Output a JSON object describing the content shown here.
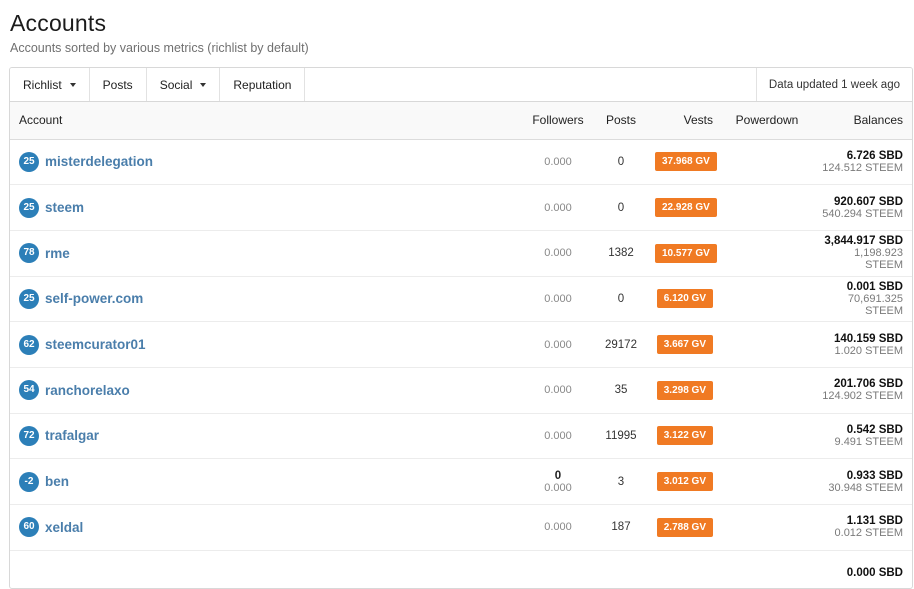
{
  "header": {
    "title": "Accounts",
    "subtitle": "Accounts sorted by various metrics (richlist by default)"
  },
  "toolbar": {
    "richlist": "Richlist",
    "posts": "Posts",
    "social": "Social",
    "reputation": "Reputation",
    "updated": "Data updated 1 week ago"
  },
  "table": {
    "columns": {
      "account": "Account",
      "followers": "Followers",
      "posts": "Posts",
      "vests": "Vests",
      "powerdown": "Powerdown",
      "balances": "Balances"
    },
    "rows": [
      {
        "rep": "25",
        "name": "misterdelegation",
        "followers_count": "",
        "followers": "0.000",
        "posts": "0",
        "vests": "37.968 GV",
        "sbd": "6.726 SBD",
        "steem": "124.512 STEEM"
      },
      {
        "rep": "25",
        "name": "steem",
        "followers_count": "",
        "followers": "0.000",
        "posts": "0",
        "vests": "22.928 GV",
        "sbd": "920.607 SBD",
        "steem": "540.294 STEEM"
      },
      {
        "rep": "78",
        "name": "rme",
        "followers_count": "",
        "followers": "0.000",
        "posts": "1382",
        "vests": "10.577 GV",
        "sbd": "3,844.917 SBD",
        "steem": "1,198.923 STEEM"
      },
      {
        "rep": "25",
        "name": "self-power.com",
        "followers_count": "",
        "followers": "0.000",
        "posts": "0",
        "vests": "6.120 GV",
        "sbd": "0.001 SBD",
        "steem": "70,691.325 STEEM"
      },
      {
        "rep": "62",
        "name": "steemcurator01",
        "followers_count": "",
        "followers": "0.000",
        "posts": "29172",
        "vests": "3.667 GV",
        "sbd": "140.159 SBD",
        "steem": "1.020 STEEM"
      },
      {
        "rep": "54",
        "name": "ranchorelaxo",
        "followers_count": "",
        "followers": "0.000",
        "posts": "35",
        "vests": "3.298 GV",
        "sbd": "201.706 SBD",
        "steem": "124.902 STEEM"
      },
      {
        "rep": "72",
        "name": "trafalgar",
        "followers_count": "",
        "followers": "0.000",
        "posts": "11995",
        "vests": "3.122 GV",
        "sbd": "0.542 SBD",
        "steem": "9.491 STEEM"
      },
      {
        "rep": "-2",
        "name": "ben",
        "followers_count": "0",
        "followers": "0.000",
        "posts": "3",
        "vests": "3.012 GV",
        "sbd": "0.933 SBD",
        "steem": "30.948 STEEM"
      },
      {
        "rep": "60",
        "name": "xeldal",
        "followers_count": "",
        "followers": "0.000",
        "posts": "187",
        "vests": "2.788 GV",
        "sbd": "1.131 SBD",
        "steem": "0.012 STEEM"
      },
      {
        "rep": "",
        "name": "",
        "followers_count": "",
        "followers": "",
        "posts": "",
        "vests": "",
        "sbd": "0.000 SBD",
        "steem": ""
      }
    ]
  }
}
